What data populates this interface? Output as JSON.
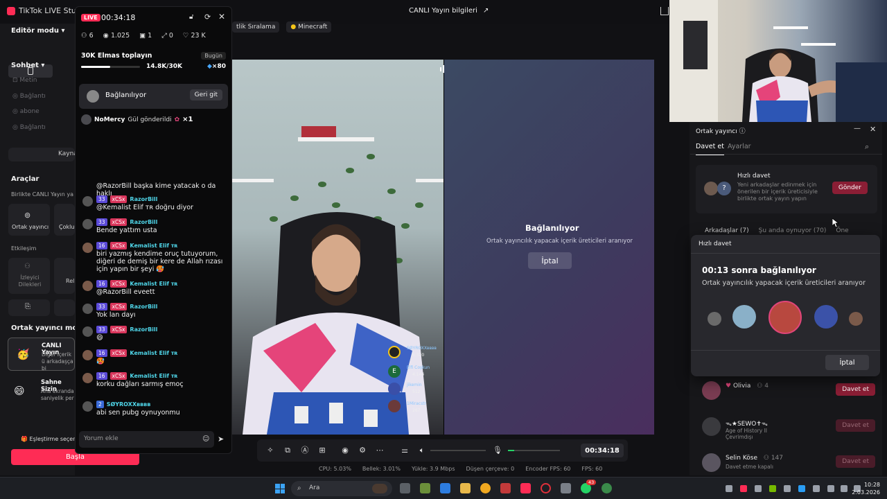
{
  "app": {
    "title": "TikTok LIVE Studio",
    "live_info": "CANLI Yayın bilgileri"
  },
  "sidebar": {
    "editor_mode": "Editör modu",
    "chat_header": "Sohbet",
    "chat_items": [
      "Metin",
      "Bağlantı",
      "abone",
      "Bağlantı"
    ],
    "source_btn": "Kayna",
    "tools_header": "Araçlar",
    "together_live": "Birlikte CANLI Yayın ya",
    "cohost_tile": "Ortak yayıncı",
    "multi_tile": "Çoklu",
    "engagement_header": "Etkileşim",
    "viewer_requests": "İzleyici Dilekleri",
    "rel_tile": "Rel",
    "cohost_mode": "Ortak yayıncı modu",
    "live_card_title": "CANLI Yayın",
    "live_card_desc": "Diğer içerik ü arkadaşça bi",
    "stage_card_title": "Sahne Sizin",
    "stage_card_desc": "Ana ekranda saniyelik per",
    "matching": "Eşleştirme seçene",
    "start": "Başla"
  },
  "chat": {
    "live_badge": "LIVE",
    "timer": "00:34:18",
    "stats": [
      {
        "icon": "users-icon",
        "value": "6"
      },
      {
        "icon": "eye-icon",
        "value": "1.025"
      },
      {
        "icon": "gift-box-icon",
        "value": "1"
      },
      {
        "icon": "share-icon",
        "value": "0"
      },
      {
        "icon": "heart-icon",
        "value": "23 K"
      }
    ],
    "goal_title": "30K Elmas toplayın",
    "goal_badge": "Bugün",
    "goal_progress": "14.8K/30K",
    "goal_fraction": 0.49,
    "goal_multiplier": "×80",
    "connecting_label": "Bağlanılıyor",
    "connecting_back": "Geri git",
    "gift_user": "NoMercy",
    "gift_text": "Gül gönderildi",
    "gift_count": "×1",
    "messages": [
      {
        "user": "",
        "text": "@RazorBill başka kime yatacak o da haklı"
      },
      {
        "user": "RazorBill",
        "level": "33",
        "fan": "xCSx",
        "text": "@Kemalist Elif ᴛʀ doğru diyor"
      },
      {
        "user": "RazorBill",
        "level": "33",
        "fan": "xCSx",
        "text": "Bende yattım usta"
      },
      {
        "user": "Kemalist Elif ᴛʀ",
        "level": "16",
        "fan": "xCSx",
        "text": "biri yazmış kendime oruç tutuyorum, diğeri de demiş bir kere de Allah rızası için yapın bir şeyi 🥵"
      },
      {
        "user": "Kemalist Elif ᴛʀ",
        "level": "16",
        "fan": "xCSx",
        "text": "@RazorBill eveett"
      },
      {
        "user": "RazorBill",
        "level": "33",
        "fan": "xCSx",
        "text": "Yok lan dayı"
      },
      {
        "user": "RazorBill",
        "level": "33",
        "fan": "xCSx",
        "text": "😄"
      },
      {
        "user": "Kemalist Elif ᴛʀ",
        "level": "16",
        "fan": "xCSx",
        "text": "🥵"
      },
      {
        "user": "Kemalist Elif ᴛʀ",
        "level": "16",
        "fan": "xCSx",
        "text": "korku dağları sarmış emoç"
      },
      {
        "user": "SØYROXXʙʙʙʙ",
        "level": "2",
        "fan": "",
        "text": "abi sen pubg oynuyonmu"
      }
    ],
    "comment_placeholder": "Yorum ekle"
  },
  "tags": [
    "tlik Sıralama",
    "Minecraft"
  ],
  "video": {
    "right_title": "Bağlanılıyor",
    "right_sub": "Ortak yayıncılık yapacak içerik üreticileri aranıyor",
    "right_btn": "İptal",
    "ranking": [
      {
        "name": "SØYROXXʙʙʙʙ",
        "score": "6.320"
      },
      {
        "name": "Elfi Coşkun",
        "score": "4.144"
      },
      {
        "name": "jikemin",
        "score": "512"
      },
      {
        "name": "1Miracstr",
        "score": "267"
      }
    ]
  },
  "controls": {
    "time": "00:34:18",
    "mic_level": 0.12
  },
  "status": {
    "cpu": "CPU: 5.03%",
    "memory": "Bellek: 3.01%",
    "upload": "Yükle: 3.9 Mbps",
    "dropped": "Düşen çerçeve: 0",
    "encoder_fps": "Encoder FPS: 60",
    "fps": "FPS: 60"
  },
  "cohost": {
    "title": "Ortak yayıncı",
    "tab_invite": "Davet et",
    "tab_settings": "Ayarlar",
    "quick_title": "Hızlı davet",
    "quick_desc": "Yeni arkadaşlar edinmek için önerilen bir içerik üreticisiyle birlikte ortak yayın yapın",
    "quick_btn": "Gönder",
    "filter_friends": "Arkadaşlar (7)",
    "filter_now": "Şu anda oynuyor (70)",
    "filter_more": "Öne",
    "popup_header": "Hızlı davet",
    "popup_title": "00:13 sonra bağlanılıyor",
    "popup_sub": "Ortak yayıncılık yapacak içerik üreticileri aranıyor",
    "popup_cancel": "İptal",
    "friends": [
      {
        "name": "Olivia",
        "sub": "",
        "count": "4",
        "btn": "Davet et",
        "dim": false
      },
      {
        "name": "ᯓ★SEWO✝ᯓ",
        "sub": "Age of History II",
        "sub2": "Çevrimdışı",
        "count": "",
        "btn": "Davet et",
        "dim": true
      },
      {
        "name": "Selin Köse",
        "sub": "Davet etme kapalı",
        "count": "147",
        "btn": "Davet et",
        "dim": true
      }
    ]
  },
  "taskbar": {
    "search": "Ara",
    "time": "10:28",
    "date": "2.03.2026",
    "whatsapp_badge": "43"
  },
  "colors": {
    "accent": "#fe2c55",
    "invite": "#8b1e35",
    "panel": "#17171a"
  }
}
